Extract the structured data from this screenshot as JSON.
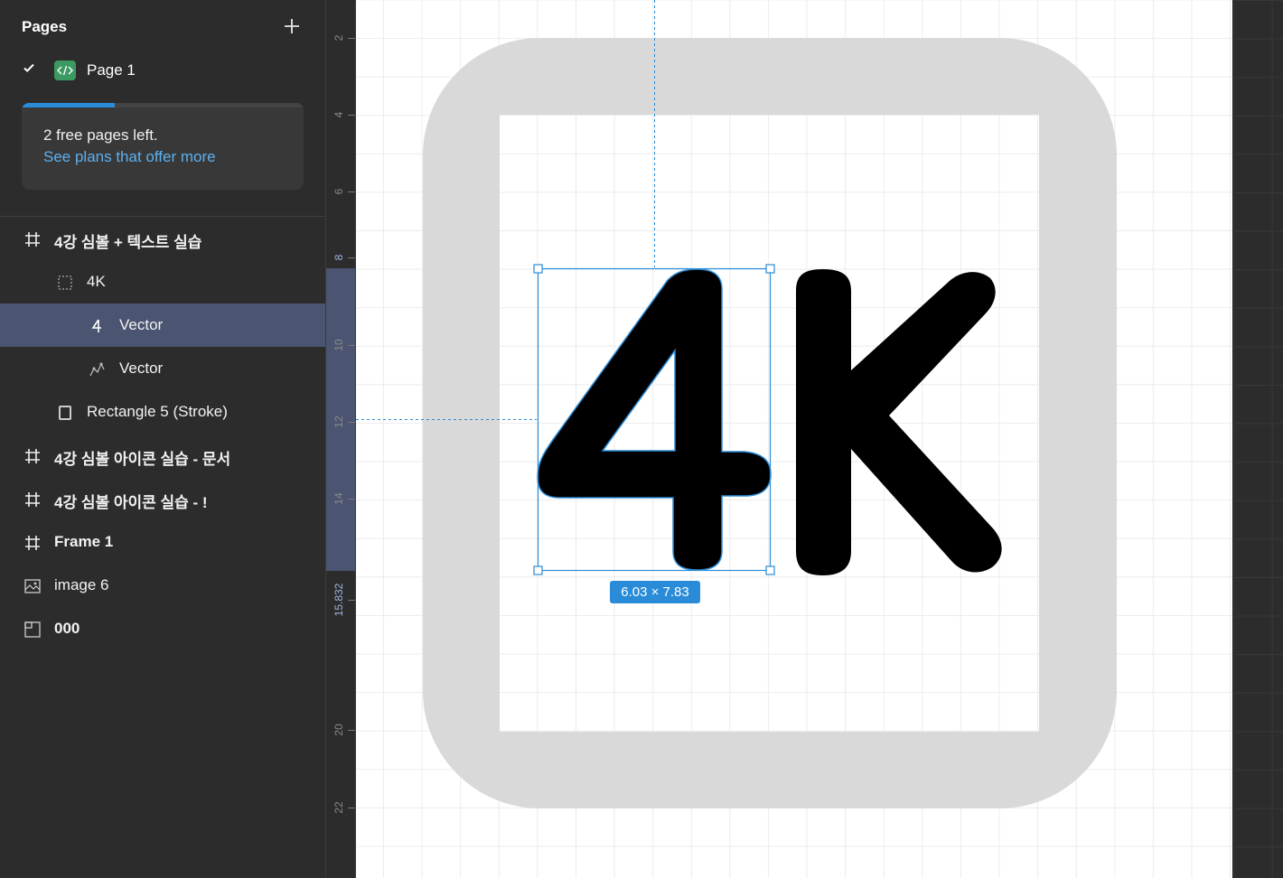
{
  "pages": {
    "header": "Pages",
    "current_page": "Page 1",
    "free_pages_text": "2 free pages left.",
    "plans_link": "See plans that offer more",
    "free_pages_used_fraction": 0.33
  },
  "layers": [
    {
      "label": "4강 심볼 + 텍스트 실습",
      "icon": "frame-hash-icon",
      "depth": 0,
      "bold": true
    },
    {
      "label": "4K",
      "icon": "group-dotted-icon",
      "depth": 1,
      "bold": false
    },
    {
      "label": "Vector",
      "icon": "vector-4-icon",
      "depth": 2,
      "bold": false,
      "selected": true
    },
    {
      "label": "Vector",
      "icon": "vector-pen-icon",
      "depth": 2,
      "bold": false
    },
    {
      "label": "Rectangle 5 (Stroke)",
      "icon": "rectangle-stroke-icon",
      "depth": 1,
      "bold": false
    },
    {
      "label": "4강 심볼 아이콘 실습 - 문서",
      "icon": "frame-hash-icon",
      "depth": 0,
      "bold": true
    },
    {
      "label": "4강 심볼 아이콘 실습 - !",
      "icon": "frame-hash-icon",
      "depth": 0,
      "bold": true
    },
    {
      "label": "Frame 1",
      "icon": "frame-hash-icon",
      "depth": 0,
      "bold": true
    },
    {
      "label": "image 6",
      "icon": "image-icon",
      "depth": 0,
      "bold": false
    },
    {
      "label": "000",
      "icon": "section-icon",
      "depth": 0,
      "bold": true
    }
  ],
  "ruler": {
    "labels": [
      "2",
      "4",
      "6",
      "8",
      "10",
      "12",
      "14",
      "15.832",
      "20",
      "22"
    ]
  },
  "canvas": {
    "dimension_label": "6.03 × 7.83",
    "colors": {
      "accent": "#2a8cd8",
      "icon_frame": "#d9d9d9",
      "glyph": "#000000",
      "selection_bg": "#4b5571"
    }
  }
}
